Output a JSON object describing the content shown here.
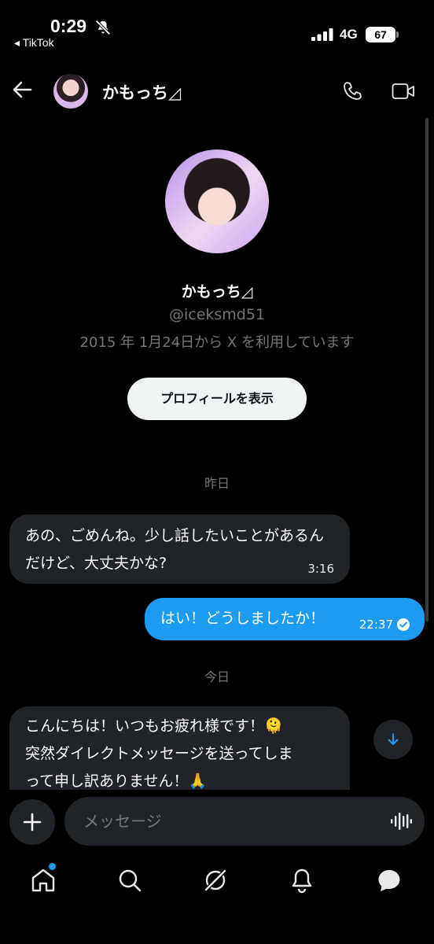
{
  "status_bar": {
    "time": "0:29",
    "back_app": "◂ TikTok",
    "network": "4G",
    "battery": "67"
  },
  "header": {
    "name": "かもっち◿"
  },
  "profile": {
    "name": "かもっち◿",
    "handle": "@iceksmd51",
    "joined": "2015 年 1月24日から X を利用しています",
    "view_profile_label": "プロフィールを表示"
  },
  "conversation": {
    "day_yesterday": "昨日",
    "day_today": "今日",
    "messages": [
      {
        "direction": "incoming",
        "text": "あの、ごめんね。少し話したいことがあるんだけど、大丈夫かな?",
        "time": "3:16"
      },
      {
        "direction": "outgoing",
        "text": "はい！どうしましたか！",
        "time": "22:37",
        "read": true
      },
      {
        "direction": "incoming",
        "text_line1": "こんにちは！いつもお疲れ様です！",
        "emoji1": "🫠",
        "text_line2": "突然ダイレクトメッセージを送ってしま",
        "text_line3": "って申し訳ありません！",
        "emoji2": "🙏"
      }
    ]
  },
  "composer": {
    "placeholder": "メッセージ"
  },
  "bottom_nav": {
    "items": [
      "home",
      "search",
      "grok",
      "notifications",
      "messages"
    ],
    "home_has_badge": true
  },
  "colors": {
    "accent": "#1d9bf0",
    "bubble_incoming": "#202327",
    "secondary_text": "#71767b"
  }
}
